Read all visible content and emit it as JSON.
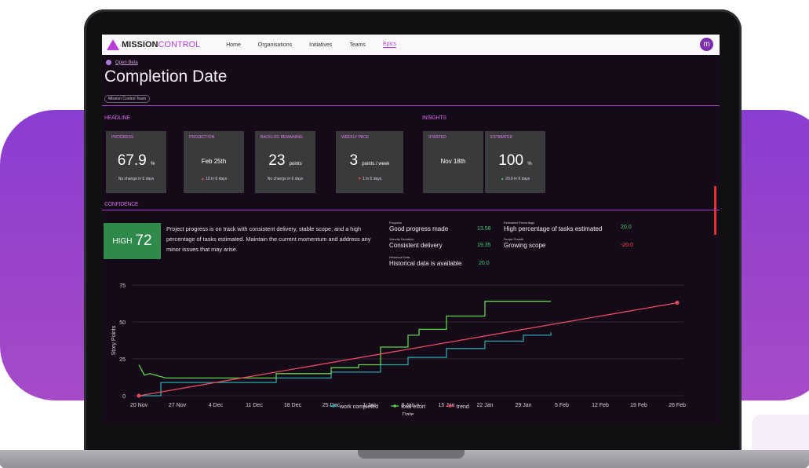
{
  "nav": {
    "logo_a": "MISSION",
    "logo_b": "CONTROL",
    "items": [
      "Home",
      "Organisations",
      "Initiatives",
      "Teams",
      "Epics"
    ],
    "avatar": "m"
  },
  "backlink": "Open Beta",
  "page_title": "Completion Date",
  "team_chip": "Mission Control Team",
  "headline": {
    "heading": "HEADLINE",
    "cards": [
      {
        "label": "PROGRESS",
        "value": "67.9",
        "unit": "%",
        "sub": "No change in 6 days",
        "arrow": ""
      },
      {
        "label": "PROJECTION",
        "value": "Feb 25th",
        "unit": "",
        "sub": "10 in 6 days",
        "arrow": "up-red"
      },
      {
        "label": "BACKLOG REMAINING",
        "value": "23",
        "unit": "points",
        "sub": "No change in 6 days",
        "arrow": ""
      },
      {
        "label": "WEEKLY PACE",
        "value": "3",
        "unit": "points / week",
        "sub": "1 in 6 days",
        "arrow": "down-red"
      }
    ]
  },
  "insights": {
    "heading": "INSIGHTS",
    "cards": [
      {
        "label": "STARTED",
        "value": "Nov 18th",
        "unit": "",
        "sub": "",
        "arrow": ""
      },
      {
        "label": "ESTIMATED",
        "value": "100",
        "unit": "%",
        "sub": "20.0 in 6 days",
        "arrow": "up-green"
      }
    ]
  },
  "confidence": {
    "heading": "CONFIDENCE",
    "level": "HIGH",
    "score": "72",
    "text": "Project progress is on track with consistent delivery, stable scope, and a high percentage of tasks estimated. Maintain the current momentum and address any minor issues that may arise.",
    "metrics": [
      {
        "label": "Progress",
        "text": "Good progress made",
        "value": "13.58"
      },
      {
        "label": "Velocity Deviation",
        "text": "Consistent delivery",
        "value": "19.35"
      },
      {
        "label": "Historical Data",
        "text": "Historical data is available",
        "value": "20.0"
      },
      {
        "label": "Estimated Percentage",
        "text": "High percentage of tasks estimated",
        "value": "20.0"
      },
      {
        "label": "Scope Growth",
        "text": "Growing scope",
        "value": "-20.0"
      }
    ]
  },
  "chart_data": {
    "type": "line",
    "xlabel": "Date",
    "ylabel": "Story Points",
    "ylim": [
      0,
      75
    ],
    "yticks": [
      "0",
      "25",
      "50",
      "75"
    ],
    "xticks": [
      "20 Nov",
      "27 Nov",
      "4 Dec",
      "11 Dec",
      "18 Dec",
      "25 Dec",
      "1 Jan",
      "8 Jan",
      "15 Jan",
      "22 Jan",
      "29 Jan",
      "5 Feb",
      "12 Feb",
      "19 Feb",
      "26 Feb"
    ],
    "grid": true,
    "legend_position": "bottom",
    "series": [
      {
        "name": "work completed",
        "color": "#2aa6a8",
        "points": [
          [
            0,
            0
          ],
          [
            4,
            0
          ],
          [
            4,
            9
          ],
          [
            25,
            9
          ],
          [
            25,
            12
          ],
          [
            35,
            12
          ],
          [
            35,
            16
          ],
          [
            44,
            16
          ],
          [
            44,
            21
          ],
          [
            49,
            21
          ],
          [
            49,
            26
          ],
          [
            56,
            26
          ],
          [
            56,
            32
          ],
          [
            63,
            32
          ],
          [
            63,
            37
          ],
          [
            70,
            37
          ],
          [
            70,
            41
          ],
          [
            75,
            41
          ],
          [
            75,
            43
          ]
        ]
      },
      {
        "name": "total effort",
        "color": "#5fd24c",
        "points": [
          [
            0,
            21
          ],
          [
            1,
            14
          ],
          [
            2,
            15
          ],
          [
            3,
            14
          ],
          [
            4,
            13
          ],
          [
            5,
            12
          ],
          [
            25,
            12
          ],
          [
            25,
            15
          ],
          [
            35,
            15
          ],
          [
            35,
            19
          ],
          [
            40,
            19
          ],
          [
            40,
            21
          ],
          [
            44,
            21
          ],
          [
            44,
            33
          ],
          [
            49,
            33
          ],
          [
            49,
            41
          ],
          [
            51,
            41
          ],
          [
            51,
            45
          ],
          [
            56,
            45
          ],
          [
            56,
            54
          ],
          [
            63,
            54
          ],
          [
            63,
            64
          ],
          [
            75,
            64
          ]
        ]
      },
      {
        "name": "trend",
        "color": "#e84a5f",
        "points": [
          [
            0,
            0
          ],
          [
            98,
            63
          ]
        ]
      }
    ]
  }
}
